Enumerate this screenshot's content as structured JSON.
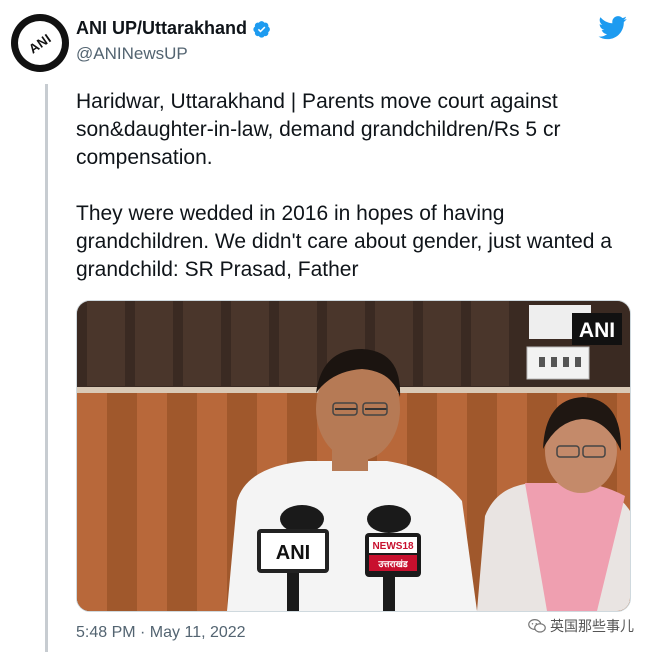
{
  "author": {
    "display_name": "ANI UP/Uttarakhand",
    "handle": "@ANINewsUP",
    "avatar_text": "ANI",
    "verified": true
  },
  "tweet": {
    "paragraph1": "Haridwar, Uttarakhand | Parents move court against son&daughter-in-law, demand grandchildren/Rs 5 cr compensation.",
    "paragraph2": "They were wedded in 2016 in hopes of having grandchildren. We didn't care about gender, just wanted a grandchild: SR Prasad, Father",
    "timestamp": "5:48 PM · May 11, 2022"
  },
  "media": {
    "corner_logo": "ANI",
    "mic_left_label": "ANI",
    "mic_right_label": "NEWS18",
    "mic_right_sublabel": "उत्तराखंड"
  },
  "watermark": {
    "text": "英国那些事儿"
  },
  "colors": {
    "twitter_blue": "#1d9bf0",
    "secondary_text": "#536471",
    "verified_blue": "#1d9bf0"
  },
  "icons": [
    "twitter-bird-icon",
    "verified-badge-icon",
    "wechat-icon"
  ]
}
